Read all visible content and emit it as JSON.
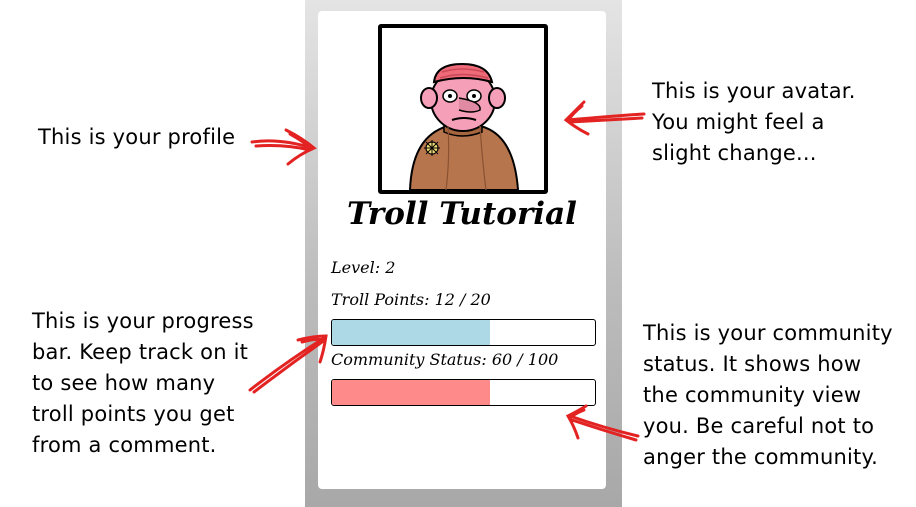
{
  "profile": {
    "name": "Troll Tutorial",
    "level_text": "Level: 2",
    "troll_points_text": "Troll Points: 12 / 20",
    "troll_points": 12,
    "troll_points_max": 20,
    "community_status_text": "Community Status: 60 / 100",
    "community_status": 60,
    "community_status_max": 100
  },
  "annotations": {
    "profile": [
      "This is your profile"
    ],
    "avatar": [
      "This is your avatar.",
      "You might feel a",
      "slight change..."
    ],
    "progress": [
      "This is your progress",
      "bar. Keep track on it",
      "to see how many",
      "troll points you get",
      "from a comment."
    ],
    "community": [
      "This is your community",
      "status. It shows how",
      "the community view",
      "you. Be careful not to",
      "anger the community."
    ]
  },
  "colors": {
    "progress_fill": "#add8e6",
    "community_fill": "#ff8a8a",
    "arrow": "#e32222"
  },
  "icons": {
    "avatar": "troll-avatar-illustration"
  }
}
